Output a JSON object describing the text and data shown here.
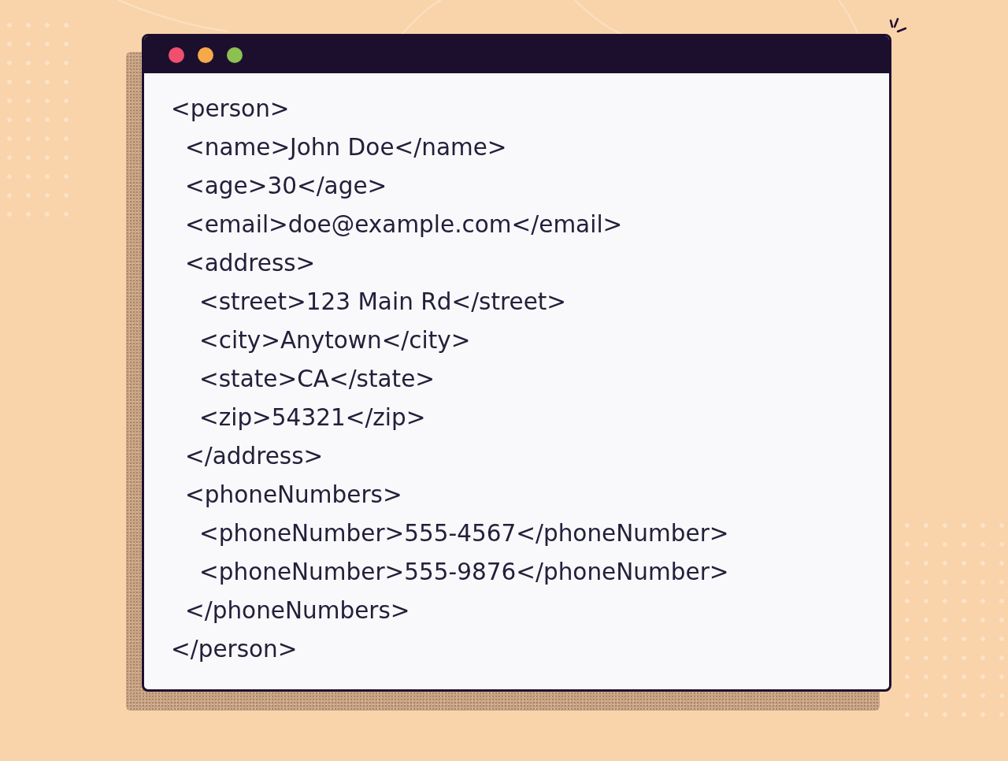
{
  "window": {
    "controls": [
      {
        "color": "#f0506e"
      },
      {
        "color": "#f7a94a"
      },
      {
        "color": "#8cc152"
      }
    ]
  },
  "code": {
    "open": "<person>",
    "close": "</person>",
    "children": [
      {
        "text": "<name>John Doe</name>"
      },
      {
        "text": "<age>30</age>"
      },
      {
        "text": "<email>doe@example.com</email>"
      },
      {
        "open": "<address>",
        "close": "</address>",
        "children": [
          {
            "text": "<street>123 Main Rd</street>"
          },
          {
            "text": "<city>Anytown</city>"
          },
          {
            "text": "<state>CA</state>"
          },
          {
            "text": "<zip>54321</zip>"
          }
        ]
      },
      {
        "open": "<phoneNumbers>",
        "close": "</phoneNumbers>",
        "children": [
          {
            "text": "<phoneNumber>555-4567</phoneNumber>"
          },
          {
            "text": "<phoneNumber>555-9876</phoneNumber>"
          }
        ]
      }
    ]
  }
}
